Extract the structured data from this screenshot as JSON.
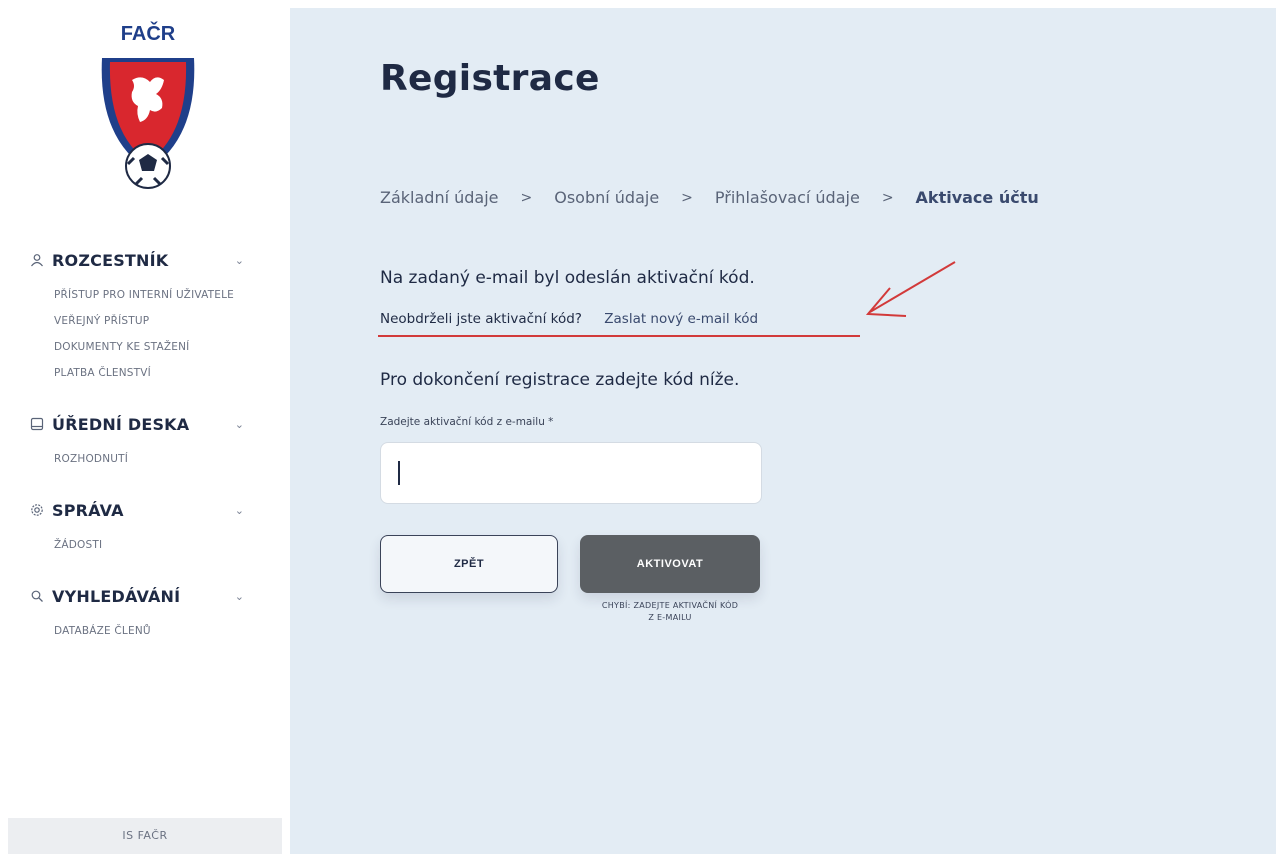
{
  "brand": {
    "logo_text": "FAČR"
  },
  "sidebar": {
    "sections": [
      {
        "title": "ROZCESTNÍK",
        "icon": "user-icon",
        "items": [
          "PŘÍSTUP PRO INTERNÍ UŽIVATELE",
          "VEŘEJNÝ PŘÍSTUP",
          "DOKUMENTY KE STAŽENÍ",
          "PLATBA ČLENSTVÍ"
        ]
      },
      {
        "title": "ÚŘEDNÍ DESKA",
        "icon": "board-icon",
        "items": [
          "ROZHODNUTÍ"
        ]
      },
      {
        "title": "SPRÁVA",
        "icon": "gear-icon",
        "items": [
          "ŽÁDOSTI"
        ]
      },
      {
        "title": "VYHLEDÁVÁNÍ",
        "icon": "search-icon",
        "items": [
          "DATABÁZE ČLENŮ"
        ]
      }
    ],
    "footer": "IS FAČR"
  },
  "main": {
    "title": "Registrace",
    "breadcrumb": [
      "Základní údaje",
      "Osobní údaje",
      "Přihlašovací údaje",
      "Aktivace účtu"
    ],
    "breadcrumb_separator": ">",
    "message": "Na zadaný e-mail byl odeslán aktivační kód.",
    "resend_question": "Neobdrželi jste aktivační kód?",
    "resend_link": "Zaslat nový e-mail kód",
    "instruction": "Pro dokončení registrace zadejte kód níže.",
    "field_label": "Zadejte aktivační kód z e-mailu *",
    "field_value": "",
    "back_label": "ZPĚT",
    "activate_label": "AKTIVOVAT",
    "error_line1": "CHYBÍ: ZADEJTE AKTIVAČNÍ KÓD",
    "error_line2": "Z E-MAILU"
  },
  "colors": {
    "main_bg": "#e3ecf4",
    "annotation": "#d23a3a",
    "activate_btn": "#5b5f63",
    "text_dark": "#1f2a44"
  }
}
